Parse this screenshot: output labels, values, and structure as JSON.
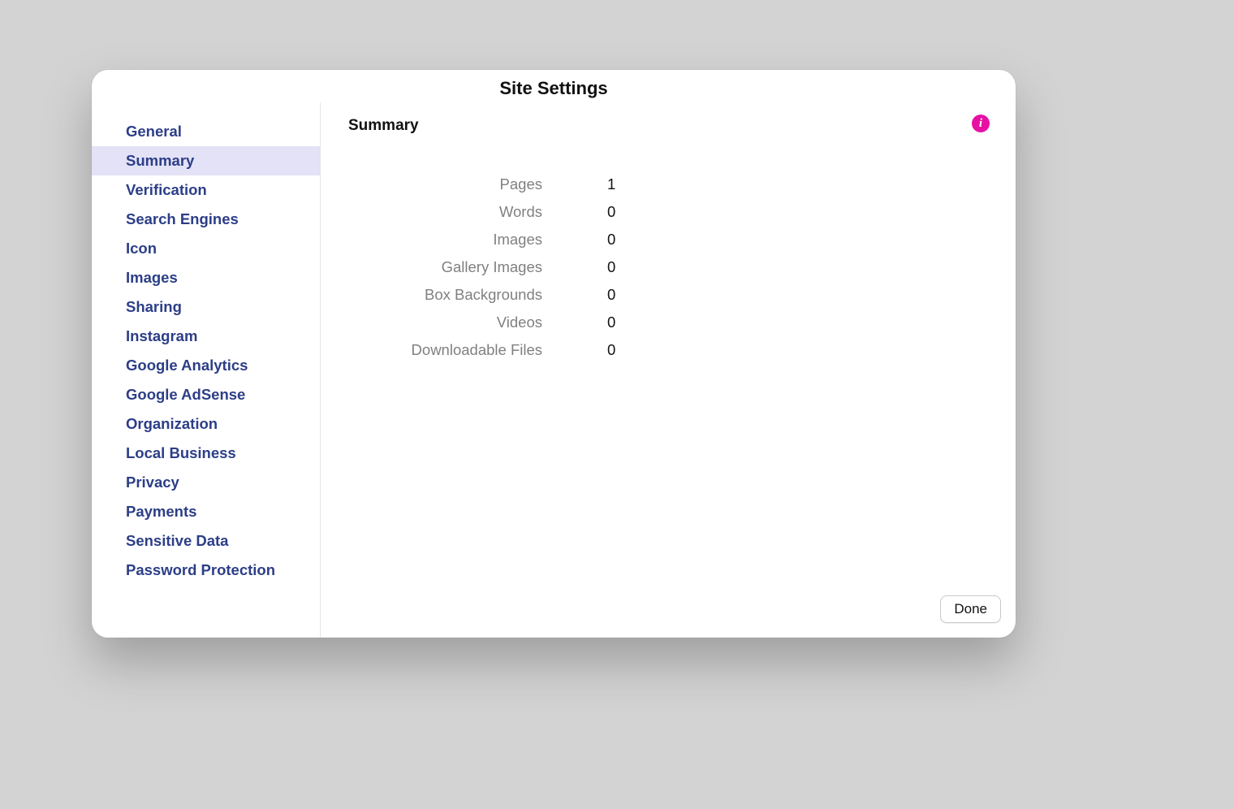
{
  "window": {
    "title": "Site Settings"
  },
  "sidebar": {
    "items": [
      {
        "id": "general",
        "label": "General",
        "selected": false
      },
      {
        "id": "summary",
        "label": "Summary",
        "selected": true
      },
      {
        "id": "verify",
        "label": "Verification",
        "selected": false
      },
      {
        "id": "search",
        "label": "Search Engines",
        "selected": false
      },
      {
        "id": "icon",
        "label": "Icon",
        "selected": false
      },
      {
        "id": "images",
        "label": "Images",
        "selected": false
      },
      {
        "id": "sharing",
        "label": "Sharing",
        "selected": false
      },
      {
        "id": "instagram",
        "label": "Instagram",
        "selected": false
      },
      {
        "id": "ga",
        "label": "Google Analytics",
        "selected": false
      },
      {
        "id": "adsense",
        "label": "Google AdSense",
        "selected": false
      },
      {
        "id": "org",
        "label": "Organization",
        "selected": false
      },
      {
        "id": "local",
        "label": "Local Business",
        "selected": false
      },
      {
        "id": "privacy",
        "label": "Privacy",
        "selected": false
      },
      {
        "id": "payments",
        "label": "Payments",
        "selected": false
      },
      {
        "id": "sensitive",
        "label": "Sensitive Data",
        "selected": false
      },
      {
        "id": "password",
        "label": "Password Protection",
        "selected": false
      }
    ]
  },
  "content": {
    "section_title": "Summary",
    "info_icon": "info-icon",
    "stats": [
      {
        "label": "Pages",
        "value": "1"
      },
      {
        "label": "Words",
        "value": "0"
      },
      {
        "label": "Images",
        "value": "0"
      },
      {
        "label": "Gallery Images",
        "value": "0"
      },
      {
        "label": "Box Backgrounds",
        "value": "0"
      },
      {
        "label": "Videos",
        "value": "0"
      },
      {
        "label": "Downloadable Files",
        "value": "0"
      }
    ]
  },
  "footer": {
    "done_label": "Done"
  }
}
